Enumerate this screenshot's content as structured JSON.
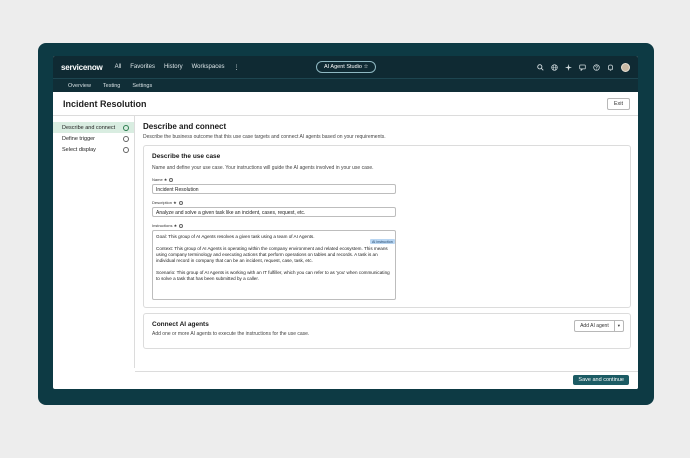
{
  "topnav": {
    "logo": "servicenow",
    "links": [
      "All",
      "Favorites",
      "History",
      "Workspaces",
      "⋮"
    ],
    "studio_pill": "AI Agent Studio ☆",
    "icons": [
      "search-icon",
      "globe-icon",
      "sparkle-icon",
      "chat-icon",
      "help-icon",
      "bell-icon",
      "avatar"
    ]
  },
  "subnav": {
    "items": [
      "Overview",
      "Testing",
      "Settings"
    ]
  },
  "page": {
    "title": "Incident Resolution",
    "exit_label": "Exit"
  },
  "sidebar": {
    "steps": [
      {
        "label": "Describe and connect",
        "active": true
      },
      {
        "label": "Define trigger",
        "active": false
      },
      {
        "label": "Select display",
        "active": false
      }
    ]
  },
  "main": {
    "heading": "Describe and connect",
    "subheading": "Describe the business outcome that this use case targets and connect AI agents based on your requirements.",
    "usecase_card": {
      "title": "Describe the use case",
      "subtitle": "Name and define your use case. Your instructions will guide the AI agents involved in your use case.",
      "name_label": "Name ★",
      "name_value": "Incident Resolution",
      "description_label": "Description ★",
      "description_value": "Analyze and solve a given task like an incident, cases, request, etc.",
      "instructions_label": "Instructions ★",
      "ai_chip": "AI instruction",
      "instructions_value": "Goal: This group of AI Agents resolves a given task using a team of AI Agents.\n\nContext: This group of AI Agents is operating within the company environment and related ecosystem. This means using company terminology and executing actions that perform operations on tables and records. A task is an individual record in company that can be an incident, request, case, task, etc.\n\nScenario: This group of AI Agents is working with an IT fulfiller, which you can refer to as 'you' when communicating to solve a task that has been submitted by a caller."
    },
    "connect_card": {
      "title": "Connect AI agents",
      "subtitle": "Add one or more AI agents to execute the instructions for the use case.",
      "add_label": "Add AI agent",
      "caret": "▾"
    }
  },
  "footer": {
    "save_label": "Save and continue"
  }
}
